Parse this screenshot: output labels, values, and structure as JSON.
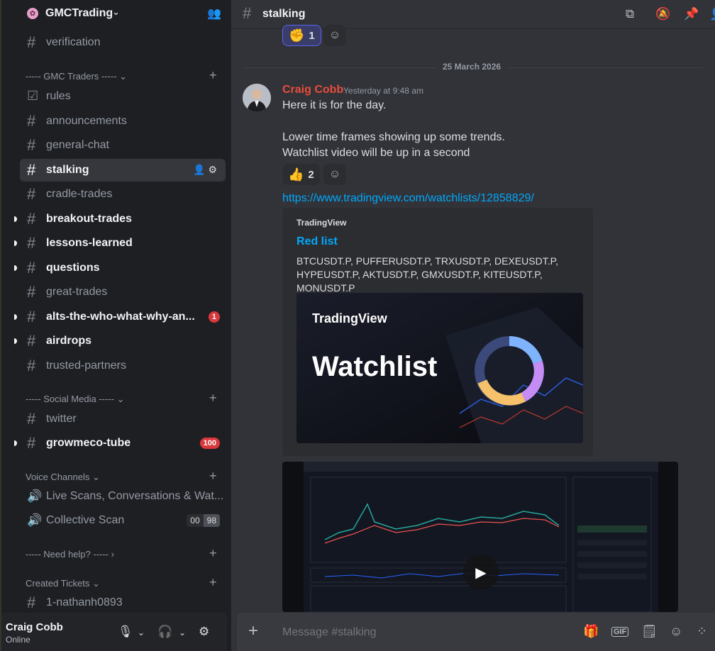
{
  "server": {
    "name": "GMCTrading"
  },
  "sidebar": {
    "channels": [
      {
        "name": "verification",
        "type": "text",
        "state": "normal"
      },
      {
        "category": "----- GMC Traders -----"
      },
      {
        "name": "rules",
        "type": "rules",
        "state": "normal"
      },
      {
        "name": "announcements",
        "type": "text",
        "state": "normal"
      },
      {
        "name": "general-chat",
        "type": "text",
        "state": "normal"
      },
      {
        "name": "stalking",
        "type": "text",
        "state": "active"
      },
      {
        "name": "cradle-trades",
        "type": "text",
        "state": "normal"
      },
      {
        "name": "breakout-trades",
        "type": "text",
        "state": "unread"
      },
      {
        "name": "lessons-learned",
        "type": "text",
        "state": "unread"
      },
      {
        "name": "questions",
        "type": "text",
        "state": "unread"
      },
      {
        "name": "great-trades",
        "type": "text",
        "state": "normal"
      },
      {
        "name": "alts-the-who-what-why-an...",
        "type": "text",
        "state": "unread",
        "badge": "1"
      },
      {
        "name": "airdrops",
        "type": "text",
        "state": "unread"
      },
      {
        "name": "trusted-partners",
        "type": "locked",
        "state": "normal"
      }
    ],
    "categories": {
      "gmc_traders": "----- GMC Traders -----",
      "social_media": "----- Social Media -----",
      "voice": "Voice Channels",
      "need_help": "----- Need help? -----",
      "tickets": "Created Tickets"
    },
    "social": [
      {
        "name": "twitter",
        "state": "normal"
      },
      {
        "name": "growmeco-tube",
        "state": "unread",
        "badge": "100"
      }
    ],
    "voice_channels": [
      {
        "name": "Live Scans, Conversations & Wat..."
      },
      {
        "name": "Collective Scan",
        "count_a": "00",
        "count_b": "98"
      }
    ],
    "tickets": [
      {
        "name": "1-nathanh0893"
      }
    ]
  },
  "user": {
    "name": "Craig Cobb",
    "status": "Online"
  },
  "channel": {
    "title": "stalking"
  },
  "messages": {
    "prev_reaction": {
      "emoji": "✊",
      "count": "1"
    },
    "date_divider": "25 March 2026",
    "author": "Craig Cobb",
    "timestamp": "Yesterday at 9:48 am",
    "lines": [
      "Here it is for the day.",
      "Lower time frames showing up some trends.",
      "Watchlist video will be up in a second"
    ],
    "reaction": {
      "emoji": "👍",
      "count": "2"
    },
    "link": "https://www.tradingview.com/watchlists/12858829/",
    "embed": {
      "provider": "TradingView",
      "title": "Red list",
      "description": "BTCUSDT.P, PUFFERUSDT.P, TRXUSDT.P, DEXEUSDT.P, HYPEUSDT.P, AKTUSDT.P, GMXUSDT.P, KITEUSDT.P, MONUSDT.P",
      "image_logo": "TradingView",
      "image_title": "Watchlist"
    }
  },
  "composer": {
    "placeholder": "Message #stalking"
  },
  "colors": {
    "accent": "#5865f2",
    "author": "#e74c3c",
    "link": "#00a8fc",
    "badge": "#da373c"
  }
}
